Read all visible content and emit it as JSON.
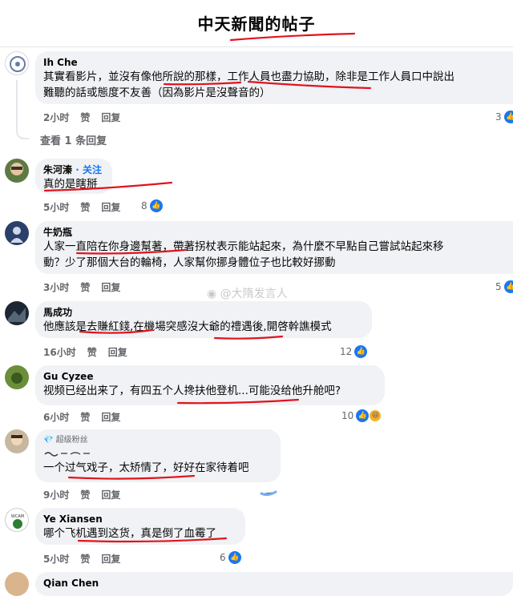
{
  "page_title": "中天新聞的帖子",
  "colors": {
    "accent": "#1877f2",
    "annotation": "#e0141e",
    "bubble": "#f0f2f5"
  },
  "comments": [
    {
      "name": "Ih Che",
      "lines": [
        "其實看影片，並沒有像他所說的那樣，工作人員也盡力協助，除非是工作人員口中說出",
        "難聽的話或態度不友善（因為影片是沒聲音的）"
      ],
      "time": "2小时",
      "like": "赞",
      "reply": "回复",
      "count": "3"
    },
    {
      "view_replies": "查看 1 条回复"
    },
    {
      "name": "朱河溱",
      "follow": "· 关注",
      "lines": [
        "真的是瞎掰"
      ],
      "time": "5小时",
      "like": "赞",
      "reply": "回复",
      "count": "8"
    },
    {
      "name": "牛奶瓶",
      "lines": [
        "人家一直陪在你身邊幫著，帶著拐杖表示能站起來，為什麼不早點自己嘗試站起來移",
        "動？少了那個大台的輪椅，人家幫你挪身體位子也比較好挪動"
      ],
      "time": "3小时",
      "like": "赞",
      "reply": "回复",
      "count": "5"
    },
    {
      "name": "馬成功",
      "lines": [
        "他應該是去賺紅錢,在機場突感沒大爺的禮遇後,開啓幹譙模式"
      ],
      "time": "16小时",
      "like": "赞",
      "reply": "回复",
      "count": "12"
    },
    {
      "name": "Gu Cyzee",
      "lines": [
        "视频已经出来了，有四五个人搀扶他登机...可能没给他升舱吧?"
      ],
      "time": "6小时",
      "like": "赞",
      "reply": "回复",
      "count": "10"
    },
    {
      "badge": "超级粉丝",
      "lines": [
        "一个过气戏子，太矫情了，好好在家待着吧"
      ],
      "time": "9小时",
      "like": "赞",
      "reply": "回复"
    },
    {
      "name": "Ye Xiansen",
      "lines": [
        "哪个飞机遇到这货，真是倒了血霉了"
      ],
      "time": "5小时",
      "like": "赞",
      "reply": "回复",
      "count": "6"
    },
    {
      "name": "Qian Chen"
    }
  ],
  "watermark": "@大隋发言人"
}
